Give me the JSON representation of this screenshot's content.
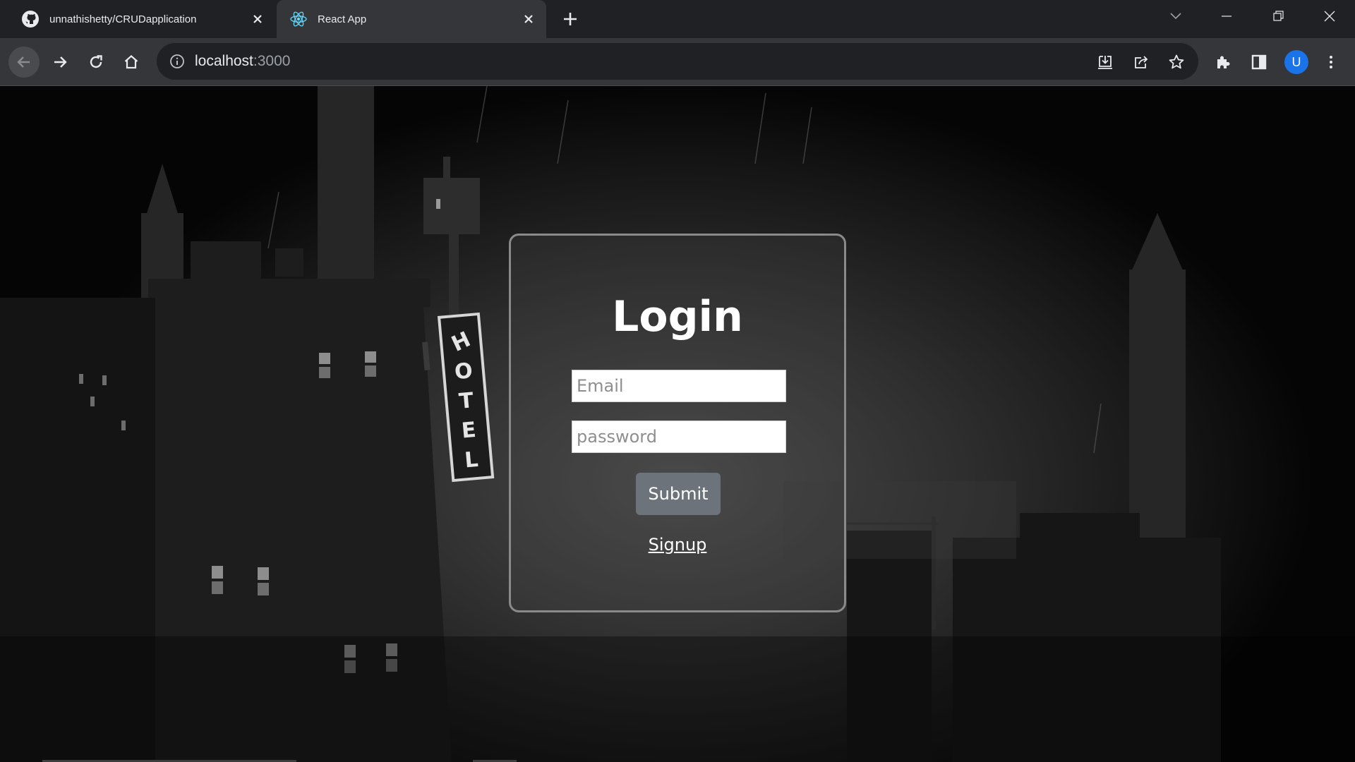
{
  "tabs": [
    {
      "title": "unnathishetty/CRUDapplication",
      "favicon": "github-icon",
      "active": false
    },
    {
      "title": "React App",
      "favicon": "react-icon",
      "active": true
    }
  ],
  "address_bar": {
    "host": "localhost",
    "port": ":3000"
  },
  "profile": {
    "initial": "U",
    "color": "#1a73e8"
  },
  "page": {
    "background_sign": "HOTEL",
    "login": {
      "title": "Login",
      "email_placeholder": "Email",
      "password_placeholder": "password",
      "submit_label": "Submit",
      "signup_label": "Signup"
    }
  },
  "colors": {
    "tabstrip": "#202124",
    "toolbar": "#35363a",
    "submit_button": "#6c737a",
    "card_border": "#8a8a8a"
  }
}
